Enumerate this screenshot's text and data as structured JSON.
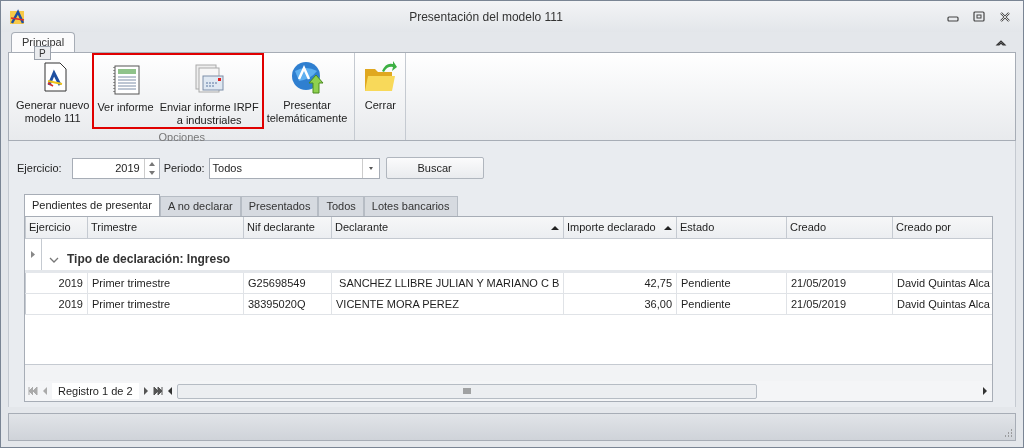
{
  "window": {
    "title": "Presentación del modelo 111"
  },
  "ribbon": {
    "tabs": [
      {
        "label": "Principal",
        "selected": true,
        "keytip": "P"
      }
    ],
    "groups": [
      {
        "label": "Opciones",
        "buttons": [
          {
            "label": "Generar nuevo\nmodelo 111",
            "kind": "document",
            "highlighted": false
          },
          {
            "label": "Ver informe",
            "kind": "report",
            "highlighted": true
          },
          {
            "label": "Enviar informe IRPF\na industriales",
            "kind": "send",
            "highlighted": true
          },
          {
            "label": "Presentar\ntelemáticamente",
            "kind": "globe",
            "highlighted": false
          }
        ]
      },
      {
        "buttons": [
          {
            "label": "Cerrar",
            "kind": "folder",
            "highlighted": false
          }
        ]
      }
    ]
  },
  "filters": {
    "ejercicio_label": "Ejercicio:",
    "ejercicio": "2019",
    "periodo_label": "Periodo:",
    "periodo": "Todos",
    "search_button": "Buscar"
  },
  "tabs": [
    {
      "label": "Pendientes de presentar",
      "selected": true
    },
    {
      "label": "A no declarar",
      "selected": false
    },
    {
      "label": "Presentados",
      "selected": false
    },
    {
      "label": "Todos",
      "selected": false
    },
    {
      "label": "Lotes bancarios",
      "selected": false
    }
  ],
  "table": {
    "columns": [
      {
        "label": "Ejercicio",
        "sorted": false
      },
      {
        "label": "Trimestre",
        "sorted": false
      },
      {
        "label": "Nif declarante",
        "sorted": false
      },
      {
        "label": "Declarante",
        "sorted": true
      },
      {
        "label": "Importe declarado",
        "sorted": true
      },
      {
        "label": "Estado",
        "sorted": false
      },
      {
        "label": "Creado",
        "sorted": false
      },
      {
        "label": "Creado por",
        "sorted": false
      }
    ],
    "group": {
      "label": "Tipo de declaración: Ingreso",
      "expanded": true,
      "focused": true
    },
    "rows": [
      {
        "cells": [
          "2019",
          "Primer trimestre",
          "G25698549",
          " SANCHEZ LLIBRE JULIAN Y MARIANO C B",
          "42,75",
          "Pendiente",
          "21/05/2019",
          "David Quintas Alca"
        ]
      },
      {
        "cells": [
          "2019",
          "Primer trimestre",
          "38395020Q",
          "VICENTE MORA PEREZ",
          "36,00",
          "Pendiente",
          "21/05/2019",
          "David Quintas Alca"
        ]
      }
    ],
    "navigator": "Registro 1 de 2"
  }
}
